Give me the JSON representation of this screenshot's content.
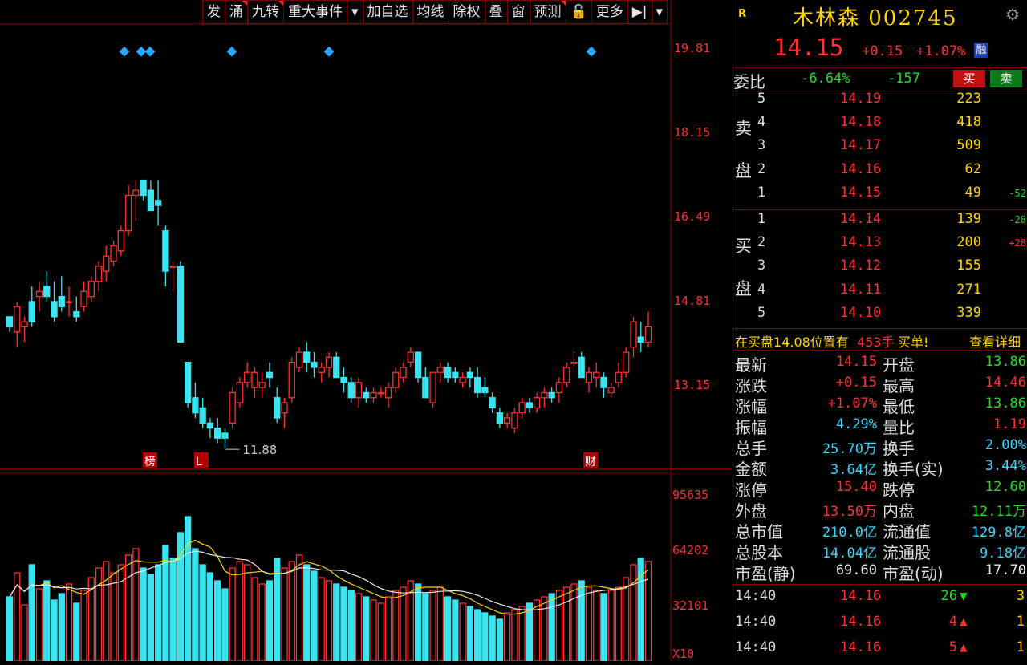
{
  "toolbar": {
    "items": [
      {
        "label": "发",
        "flag": false
      },
      {
        "label": "涌",
        "flag": true
      },
      {
        "label": "九转",
        "flag": true
      },
      {
        "label": "重大事件",
        "flag": false
      },
      {
        "label": "▾",
        "flag": false
      },
      {
        "label": "加自选",
        "flag": false
      },
      {
        "label": "均线",
        "flag": false
      },
      {
        "label": "除权",
        "flag": false
      },
      {
        "label": "叠",
        "flag": false
      },
      {
        "label": "窗",
        "flag": false
      },
      {
        "label": "预测",
        "flag": true
      },
      {
        "label": "🔓",
        "flag": false
      },
      {
        "label": "更多",
        "flag": false
      },
      {
        "label": "▶|",
        "flag": false
      },
      {
        "label": "▾",
        "flag": false
      }
    ]
  },
  "chart": {
    "price_ticks": [
      "19.81",
      "18.15",
      "16.49",
      "14.81",
      "13.15"
    ],
    "volume_ticks": [
      "95635",
      "64202",
      "32101",
      "X10"
    ],
    "min_label": "11.88",
    "markers": [
      "榜",
      "L",
      "财"
    ]
  },
  "chart_data": {
    "type": "candlestick",
    "low_marker": 11.88,
    "candles": [
      [
        14.5,
        14.5,
        14.2,
        14.3
      ],
      [
        14.2,
        14.8,
        13.9,
        14.7
      ],
      [
        14.3,
        14.5,
        14.0,
        14.4
      ],
      [
        14.8,
        15.1,
        14.3,
        14.4
      ],
      [
        14.9,
        15.2,
        14.6,
        15.0
      ],
      [
        15.1,
        15.4,
        14.8,
        14.9
      ],
      [
        14.8,
        15.2,
        14.4,
        14.5
      ],
      [
        14.9,
        15.3,
        14.6,
        14.7
      ],
      [
        14.8,
        15.1,
        14.5,
        14.8
      ],
      [
        14.6,
        14.9,
        14.4,
        14.5
      ],
      [
        14.7,
        15.2,
        14.6,
        15.0
      ],
      [
        14.9,
        15.3,
        14.8,
        15.2
      ],
      [
        15.2,
        15.6,
        15.0,
        15.5
      ],
      [
        15.4,
        15.9,
        15.2,
        15.7
      ],
      [
        15.6,
        16.0,
        15.5,
        15.9
      ],
      [
        15.8,
        16.3,
        15.7,
        16.2
      ],
      [
        16.2,
        17.1,
        16.1,
        16.9
      ],
      [
        16.9,
        17.2,
        16.4,
        17.0
      ],
      [
        17.2,
        17.2,
        16.8,
        16.9
      ],
      [
        17.0,
        17.2,
        16.6,
        16.6
      ],
      [
        16.8,
        17.2,
        16.3,
        16.7
      ],
      [
        16.2,
        16.3,
        15.1,
        15.4
      ],
      [
        15.5,
        15.6,
        15.0,
        15.5
      ],
      [
        15.5,
        15.6,
        14.0,
        14.0
      ],
      [
        13.6,
        13.6,
        12.7,
        12.8
      ],
      [
        12.9,
        13.2,
        12.5,
        12.6
      ],
      [
        12.7,
        12.9,
        12.3,
        12.4
      ],
      [
        12.4,
        12.5,
        12.1,
        12.3
      ],
      [
        12.3,
        12.5,
        12.0,
        12.1
      ],
      [
        12.2,
        12.3,
        11.9,
        12.1
      ],
      [
        12.4,
        13.1,
        12.3,
        13.0
      ],
      [
        12.8,
        13.3,
        12.7,
        13.2
      ],
      [
        13.2,
        13.6,
        13.1,
        13.4
      ],
      [
        13.1,
        13.5,
        12.9,
        13.4
      ],
      [
        13.1,
        13.4,
        12.9,
        13.2
      ],
      [
        13.4,
        13.6,
        13.1,
        13.3
      ],
      [
        12.9,
        13.1,
        12.4,
        12.5
      ],
      [
        12.6,
        12.9,
        12.3,
        12.8
      ],
      [
        12.9,
        13.7,
        12.8,
        13.6
      ],
      [
        13.5,
        13.9,
        13.4,
        13.8
      ],
      [
        13.8,
        14.0,
        13.4,
        13.6
      ],
      [
        13.6,
        13.8,
        13.3,
        13.5
      ],
      [
        13.4,
        13.6,
        13.2,
        13.5
      ],
      [
        13.5,
        13.8,
        13.3,
        13.7
      ],
      [
        13.7,
        13.8,
        13.3,
        13.3
      ],
      [
        13.3,
        13.5,
        13.0,
        13.2
      ],
      [
        13.2,
        13.3,
        12.8,
        12.9
      ],
      [
        12.9,
        13.3,
        12.7,
        13.2
      ],
      [
        13.0,
        13.1,
        12.8,
        12.9
      ],
      [
        12.9,
        13.1,
        12.8,
        13.0
      ],
      [
        13.0,
        13.1,
        12.9,
        13.0
      ],
      [
        12.9,
        13.2,
        12.7,
        13.1
      ],
      [
        13.1,
        13.5,
        13.0,
        13.4
      ],
      [
        13.3,
        13.6,
        13.2,
        13.5
      ],
      [
        13.6,
        13.9,
        13.5,
        13.8
      ],
      [
        13.8,
        13.8,
        13.2,
        13.3
      ],
      [
        13.3,
        13.5,
        12.9,
        12.9
      ],
      [
        12.8,
        13.4,
        12.7,
        13.4
      ],
      [
        13.4,
        13.6,
        13.2,
        13.5
      ],
      [
        13.5,
        13.6,
        13.2,
        13.3
      ],
      [
        13.4,
        13.5,
        13.2,
        13.3
      ],
      [
        13.2,
        13.4,
        13.1,
        13.3
      ],
      [
        13.4,
        13.5,
        13.1,
        13.3
      ],
      [
        13.3,
        13.5,
        12.9,
        13.0
      ],
      [
        13.1,
        13.3,
        12.9,
        13.0
      ],
      [
        12.9,
        13.0,
        12.6,
        12.7
      ],
      [
        12.6,
        12.7,
        12.3,
        12.4
      ],
      [
        12.4,
        12.6,
        12.3,
        12.5
      ],
      [
        12.3,
        12.7,
        12.2,
        12.6
      ],
      [
        12.6,
        12.9,
        12.5,
        12.8
      ],
      [
        12.8,
        12.9,
        12.6,
        12.7
      ],
      [
        12.7,
        13.0,
        12.6,
        12.9
      ],
      [
        12.9,
        13.1,
        12.7,
        13.0
      ],
      [
        13.0,
        13.1,
        12.8,
        12.9
      ],
      [
        13.0,
        13.3,
        12.8,
        13.2
      ],
      [
        13.2,
        13.6,
        13.1,
        13.5
      ],
      [
        13.6,
        13.8,
        13.4,
        13.6
      ],
      [
        13.7,
        13.8,
        13.3,
        13.3
      ],
      [
        13.2,
        13.5,
        13.0,
        13.4
      ],
      [
        13.3,
        13.6,
        13.1,
        13.4
      ],
      [
        13.3,
        13.4,
        12.9,
        13.1
      ],
      [
        13.0,
        13.2,
        12.9,
        13.1
      ],
      [
        13.2,
        13.6,
        13.1,
        13.4
      ],
      [
        13.4,
        13.9,
        13.3,
        13.8
      ],
      [
        13.9,
        14.5,
        13.7,
        14.4
      ],
      [
        14.1,
        14.4,
        13.8,
        14.0
      ],
      [
        14.0,
        14.6,
        13.9,
        14.3
      ]
    ],
    "volume": [
      40,
      55,
      35,
      60,
      45,
      50,
      38,
      42,
      48,
      36,
      44,
      52,
      58,
      62,
      55,
      60,
      66,
      70,
      58,
      54,
      60,
      72,
      64,
      80,
      90,
      70,
      60,
      55,
      50,
      45,
      58,
      62,
      60,
      52,
      48,
      50,
      64,
      58,
      62,
      66,
      60,
      56,
      52,
      50,
      48,
      46,
      44,
      42,
      40,
      38,
      36,
      40,
      44,
      46,
      50,
      48,
      42,
      44,
      46,
      40,
      38,
      36,
      34,
      32,
      30,
      28,
      26,
      30,
      32,
      34,
      36,
      38,
      40,
      42,
      44,
      46,
      48,
      50,
      46,
      44,
      42,
      44,
      46,
      52,
      60,
      64,
      62
    ],
    "volume_up": [
      false,
      true,
      true,
      false,
      true,
      false,
      false,
      false,
      true,
      false,
      true,
      true,
      true,
      true,
      true,
      true,
      true,
      true,
      false,
      false,
      false,
      false,
      false,
      false,
      false,
      false,
      false,
      false,
      false,
      false,
      true,
      true,
      true,
      true,
      true,
      false,
      false,
      true,
      true,
      true,
      false,
      false,
      true,
      true,
      false,
      false,
      false,
      true,
      false,
      true,
      true,
      true,
      true,
      true,
      true,
      false,
      false,
      true,
      true,
      false,
      false,
      true,
      false,
      false,
      false,
      false,
      false,
      true,
      true,
      true,
      false,
      true,
      true,
      false,
      true,
      true,
      true,
      false,
      true,
      true,
      false,
      true,
      true,
      true,
      true,
      false,
      true
    ]
  },
  "quote": {
    "badge": "R",
    "title": "木林森 002745",
    "price": "14.15",
    "change": "+0.15",
    "change_pct": "+1.07%",
    "rong": "融",
    "weibi_label": "委比",
    "weibi_pct": "-6.64%",
    "weibi_diff": "-157",
    "buy_btn": "买",
    "sell_btn": "卖"
  },
  "orderbook": {
    "sell_label_1": "卖",
    "sell_label_2": "盘",
    "buy_label_1": "买",
    "buy_label_2": "盘",
    "sell": [
      {
        "lvl": "5",
        "price": "14.19",
        "vol": "223",
        "delta": ""
      },
      {
        "lvl": "4",
        "price": "14.18",
        "vol": "418",
        "delta": ""
      },
      {
        "lvl": "3",
        "price": "14.17",
        "vol": "509",
        "delta": ""
      },
      {
        "lvl": "2",
        "price": "14.16",
        "vol": "62",
        "delta": ""
      },
      {
        "lvl": "1",
        "price": "14.15",
        "vol": "49",
        "delta": "-52"
      }
    ],
    "buy": [
      {
        "lvl": "1",
        "price": "14.14",
        "vol": "139",
        "delta": "-28"
      },
      {
        "lvl": "2",
        "price": "14.13",
        "vol": "200",
        "delta": "+28"
      },
      {
        "lvl": "3",
        "price": "14.12",
        "vol": "155",
        "delta": ""
      },
      {
        "lvl": "4",
        "price": "14.11",
        "vol": "271",
        "delta": ""
      },
      {
        "lvl": "5",
        "price": "14.10",
        "vol": "339",
        "delta": ""
      }
    ]
  },
  "notice": {
    "text_a": "在买盘14.08位置有",
    "text_b": "453手",
    "text_c": "买单!",
    "link": "查看详细"
  },
  "stats": [
    {
      "l1": "最新",
      "v1": "14.15",
      "c1": "red",
      "l2": "开盘",
      "v2": "13.86",
      "c2": "green"
    },
    {
      "l1": "涨跌",
      "v1": "+0.15",
      "c1": "red",
      "l2": "最高",
      "v2": "14.46",
      "c2": "red"
    },
    {
      "l1": "涨幅",
      "v1": "+1.07%",
      "c1": "red",
      "l2": "最低",
      "v2": "13.86",
      "c2": "green"
    },
    {
      "l1": "振幅",
      "v1": "4.29%",
      "c1": "cyan",
      "l2": "量比",
      "v2": "1.19",
      "c2": "red"
    },
    {
      "l1": "总手",
      "v1": "25.70万",
      "c1": "cyan",
      "l2": "换手",
      "v2": "2.00%",
      "c2": "cyan"
    },
    {
      "l1": "金额",
      "v1": "3.64亿",
      "c1": "cyan",
      "l2": "换手(实)",
      "v2": "3.44%",
      "c2": "cyan"
    },
    {
      "l1": "涨停",
      "v1": "15.40",
      "c1": "red",
      "l2": "跌停",
      "v2": "12.60",
      "c2": "green"
    },
    {
      "l1": "外盘",
      "v1": "13.50万",
      "c1": "red",
      "l2": "内盘",
      "v2": "12.11万",
      "c2": "green"
    },
    {
      "l1": "总市值",
      "v1": "210.0亿",
      "c1": "cyan",
      "l2": "流通值",
      "v2": "129.8亿",
      "c2": "cyan"
    },
    {
      "l1": "总股本",
      "v1": "14.04亿",
      "c1": "cyan",
      "l2": "流通股",
      "v2": "9.18亿",
      "c2": "cyan"
    },
    {
      "l1": "市盈(静)",
      "v1": "69.60",
      "c1": "white",
      "l2": "市盈(动)",
      "v2": "17.70",
      "c2": "white"
    }
  ],
  "ticks": [
    {
      "time": "14:40",
      "price": "14.16",
      "vol": "26",
      "dir": "down",
      "n": "3"
    },
    {
      "time": "14:40",
      "price": "14.16",
      "vol": "4",
      "dir": "up",
      "n": "1"
    },
    {
      "time": "14:40",
      "price": "14.16",
      "vol": "5",
      "dir": "up",
      "n": "1"
    }
  ],
  "colors": {
    "up": "#ff3030",
    "down": "#39e4f0",
    "ma1": "#ffd400",
    "ma2": "#e8e8e8"
  }
}
